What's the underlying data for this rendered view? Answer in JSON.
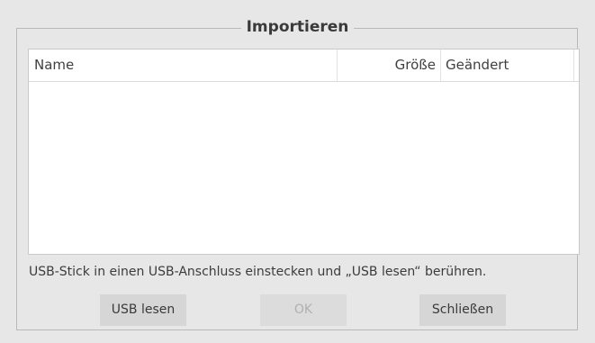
{
  "dialog": {
    "title": "Importieren"
  },
  "file_list": {
    "columns": [
      {
        "label": "Name"
      },
      {
        "label": "Größe"
      },
      {
        "label": "Geändert"
      }
    ],
    "rows": []
  },
  "hint": "USB-Stick in einen USB-Anschluss einstecken und „USB lesen“ berühren.",
  "buttons": {
    "usb_read": "USB lesen",
    "ok": "OK",
    "close": "Schließen"
  }
}
